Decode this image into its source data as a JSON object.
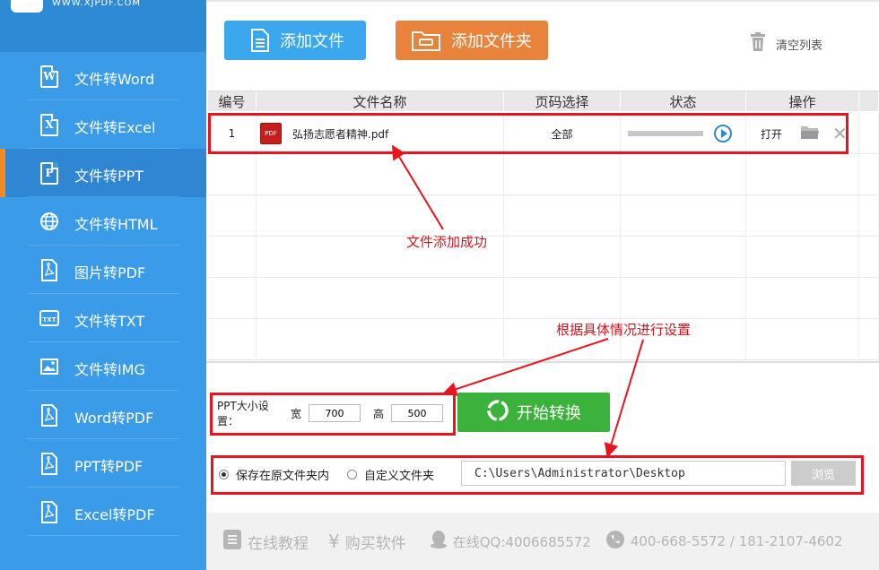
{
  "logo": {
    "text": "WWW.XJPDF.COM"
  },
  "sidebar": {
    "items": [
      {
        "label": "文件转Word",
        "icon": "word-doc-icon",
        "glyph": "W"
      },
      {
        "label": "文件转Excel",
        "icon": "excel-doc-icon",
        "glyph": "X"
      },
      {
        "label": "文件转PPT",
        "icon": "ppt-doc-icon",
        "glyph": "P",
        "active": true
      },
      {
        "label": "文件转HTML",
        "icon": "globe-icon"
      },
      {
        "label": "图片转PDF",
        "icon": "pdf-doc-icon"
      },
      {
        "label": "文件转TXT",
        "icon": "txt-doc-icon"
      },
      {
        "label": "文件转IMG",
        "icon": "image-icon"
      },
      {
        "label": "Word转PDF",
        "icon": "pdf-doc-icon"
      },
      {
        "label": "PPT转PDF",
        "icon": "pdf-doc-icon"
      },
      {
        "label": "Excel转PDF",
        "icon": "pdf-doc-icon"
      }
    ]
  },
  "toolbar": {
    "add_file": "添加文件",
    "add_folder": "添加文件夹",
    "clear_list": "清空列表"
  },
  "table": {
    "headers": [
      "编号",
      "文件名称",
      "页码选择",
      "状态",
      "操作"
    ],
    "rows": [
      {
        "num": "1",
        "icon_label": "PDF",
        "name": "弘扬志愿者精神.pdf",
        "pages": "全部",
        "progress": 0,
        "open": "打开"
      }
    ]
  },
  "settings": {
    "ppt_size_label": "PPT大小设置：",
    "width_label": "宽",
    "width_value": "700",
    "height_label": "高",
    "height_value": "500",
    "start_button": "开始转换",
    "save_original": "保存在原文件夹内",
    "custom_folder": "自定义文件夹",
    "path": "C:\\Users\\Administrator\\Desktop",
    "browse": "浏览"
  },
  "footer": {
    "tutorial": "在线教程",
    "buy": "购买软件",
    "qq": "在线QQ:4006685572",
    "phone": "400-668-5572 / 181-2107-4602"
  },
  "annotations": {
    "file_added": "文件添加成功",
    "set_as_needed": "根据具体情况进行设置"
  },
  "colors": {
    "sidebar_bg": "#3a9be8",
    "active_marker": "#f28a23",
    "add_file_btn": "#3aa7ef",
    "add_folder_btn": "#e9833b",
    "start_btn": "#3bb23b",
    "annotation_red": "#e8141e"
  }
}
